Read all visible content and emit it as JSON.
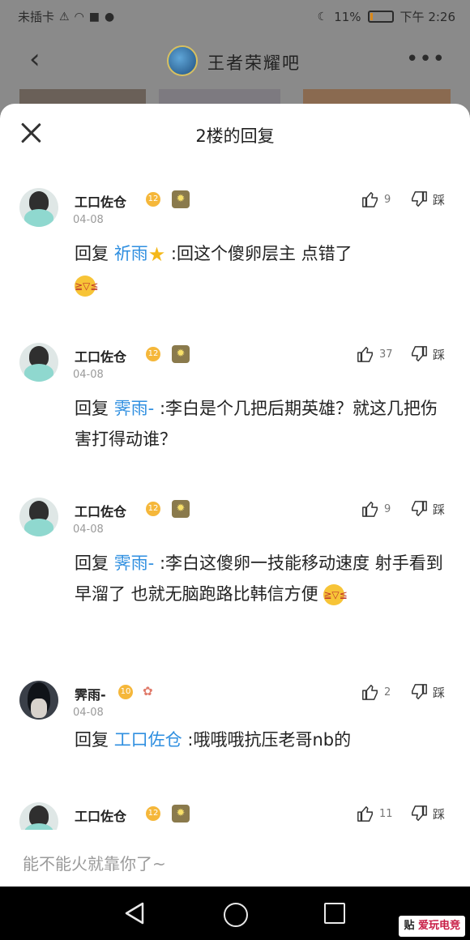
{
  "status_bar": {
    "carrier": "未插卡",
    "battery_percent": "11%",
    "time": "下午 2:26",
    "battery_level": 0.11,
    "icons": [
      "sim-warning-icon",
      "wifi-icon",
      "camera-icon",
      "qq-icon",
      "moon-icon",
      "battery-icon"
    ]
  },
  "header": {
    "forum_name": "王者荣耀吧",
    "back_icon": "chevron-left-icon",
    "more_icon": "more-dots-icon"
  },
  "sheet": {
    "title": "2楼的回复",
    "close_icon": "close-icon"
  },
  "replies": [
    {
      "user": "工口佐仓",
      "level": "12",
      "date": "04-08",
      "likes": "9",
      "dislike_label": "踩",
      "reply_prefix": "回复",
      "mention": "祈雨",
      "content": ":回这个傻卵层主 点错了"
    },
    {
      "user": "工口佐仓",
      "level": "12",
      "date": "04-08",
      "likes": "37",
      "dislike_label": "踩",
      "reply_prefix": "回复",
      "mention": "霁雨-",
      "content": ":李白是个几把后期英雄？就这几把伤害打得动谁？"
    },
    {
      "user": "工口佐仓",
      "level": "12",
      "date": "04-08",
      "likes": "9",
      "dislike_label": "踩",
      "reply_prefix": "回复",
      "mention": "霁雨-",
      "content": ":李白这傻卵一技能移动速度 射手看到早溜了 也就无脑跑路比韩信方便"
    },
    {
      "user": "霁雨-",
      "level": "10",
      "date": "04-08",
      "likes": "2",
      "dislike_label": "踩",
      "reply_prefix": "回复",
      "mention": "工口佐仓",
      "content": ":哦哦哦抗压老哥nb的"
    },
    {
      "user": "工口佐仓",
      "level": "12",
      "likes": "11",
      "dislike_label": "踩"
    }
  ],
  "input": {
    "placeholder": "能不能火就靠你了~"
  },
  "watermark": {
    "tie_char": "贴",
    "brand": "爱玩电竞"
  },
  "colors": {
    "mention": "#2f8fe0",
    "level_badge": "#f5b73a",
    "overlay": "#8a8a8a"
  }
}
